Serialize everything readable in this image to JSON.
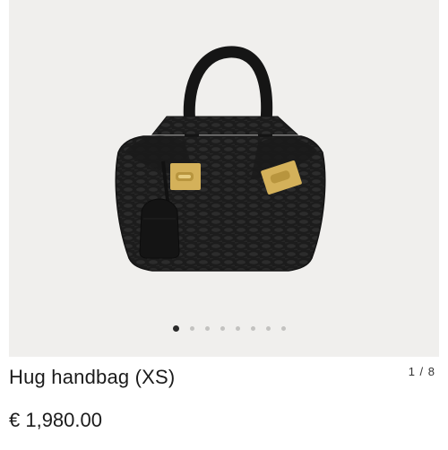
{
  "product": {
    "title": "Hug handbag (XS)",
    "price": "€ 1,980.00",
    "image_counter": "1 / 8",
    "image_subject": "handbag-image"
  },
  "carousel": {
    "total": 8,
    "active_index": 0
  },
  "colors": {
    "background": "#f0efed",
    "bag": "#1c1c1c",
    "hardware": "#d4b15a",
    "dot_active": "#2a2a2a",
    "dot_inactive": "#c3c2c0"
  }
}
